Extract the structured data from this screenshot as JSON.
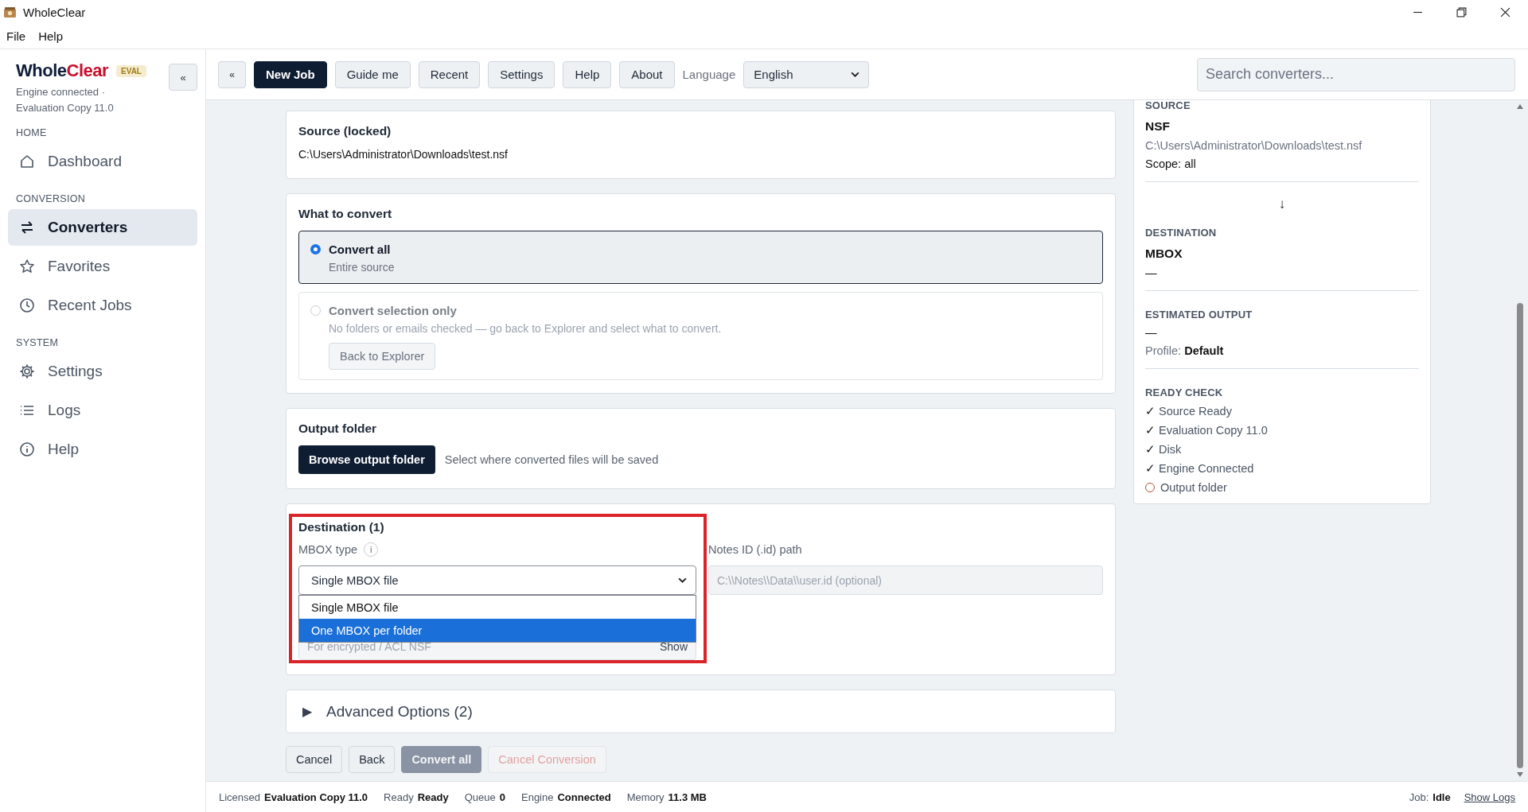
{
  "window": {
    "title": "WholeClear"
  },
  "menu": [
    "File",
    "Help"
  ],
  "sidebar": {
    "brand": {
      "primary": "Whole",
      "accent": "Clear"
    },
    "badge": "EVAL",
    "collapse": "«",
    "status": "Engine connected · Evaluation Copy 11.0",
    "sections": [
      {
        "title": "HOME",
        "items": [
          {
            "label": "Dashboard",
            "kind": "home",
            "selected": false
          }
        ]
      },
      {
        "title": "CONVERSION",
        "items": [
          {
            "label": "Converters",
            "kind": "swap",
            "selected": true
          },
          {
            "label": "Favorites",
            "kind": "star",
            "selected": false
          },
          {
            "label": "Recent Jobs",
            "kind": "clock",
            "selected": false
          }
        ]
      },
      {
        "title": "SYSTEM",
        "items": [
          {
            "label": "Settings",
            "kind": "gear",
            "selected": false
          },
          {
            "label": "Logs",
            "kind": "list",
            "selected": false
          },
          {
            "label": "Help",
            "kind": "info",
            "selected": false
          }
        ]
      }
    ]
  },
  "toolbar": {
    "collapse": "«",
    "buttons": [
      {
        "label": "New Job",
        "selected": true
      },
      {
        "label": "Guide me",
        "selected": false
      },
      {
        "label": "Recent",
        "selected": false
      },
      {
        "label": "Settings",
        "selected": false
      },
      {
        "label": "Help",
        "selected": false
      },
      {
        "label": "About",
        "selected": false
      }
    ],
    "language_label": "Language",
    "language": "English",
    "search": {
      "placeholder": "Search converters..."
    }
  },
  "source": {
    "title": "Source (locked)",
    "path": "C:\\Users\\Administrator\\Downloads\\test.nsf"
  },
  "what_to_convert": {
    "title": "What to convert",
    "options": [
      {
        "title": "Convert all",
        "subtitle": "Entire source",
        "selected": true,
        "disabled": false
      },
      {
        "title": "Convert selection only",
        "subtitle": "No folders or emails checked — go back to Explorer and select what to convert.",
        "selected": false,
        "disabled": true,
        "button": "Back to Explorer"
      }
    ]
  },
  "output_folder": {
    "title": "Output folder",
    "button": "Browse output folder",
    "hint": "Select where converted files will be saved"
  },
  "destination": {
    "title": "Destination (1)",
    "mbox_type": {
      "label": "MBOX type",
      "info": "i",
      "value": "Single MBOX file",
      "expanded": true,
      "options": [
        {
          "label": "Single MBOX file",
          "highlighted": false
        },
        {
          "label": "One MBOX per folder",
          "highlighted": true
        }
      ]
    },
    "notes_id": {
      "label": "Notes ID (.id) path",
      "placeholder": "C:\\\\Notes\\\\Data\\\\user.id (optional)"
    },
    "password": {
      "placeholder": "For encrypted / ACL NSF",
      "toggle": "Show"
    }
  },
  "advanced": {
    "label": "Advanced Options (2)",
    "toggle": "▶",
    "expanded": false
  },
  "actions": [
    {
      "label": "Cancel",
      "kind": "default",
      "disabled": false
    },
    {
      "label": "Back",
      "kind": "default",
      "disabled": false
    },
    {
      "label": "Convert all",
      "kind": "primary",
      "disabled": true
    },
    {
      "label": "Cancel Conversion",
      "kind": "danger",
      "disabled": true
    }
  ],
  "summary": {
    "source": {
      "label": "SOURCE",
      "value": "NSF",
      "path": "C:\\Users\\Administrator\\Downloads\\test.nsf",
      "scope": "Scope: all"
    },
    "arrow": "↓",
    "destination": {
      "label": "DESTINATION",
      "value": "MBOX",
      "detail": "—"
    },
    "estimate": {
      "label": "ESTIMATED OUTPUT",
      "value": "—",
      "profile": "Profile: **Default**"
    },
    "ready": {
      "label": "READY CHECK",
      "items": [
        {
          "mark": "✓",
          "label": "Source Ready",
          "done": true
        },
        {
          "mark": "✓",
          "label": "Evaluation Copy 11.0",
          "done": true
        },
        {
          "mark": "✓",
          "label": "Disk",
          "done": true
        },
        {
          "mark": "✓",
          "label": "Engine Connected",
          "done": true
        },
        {
          "label": "Output folder",
          "done": false
        }
      ]
    }
  },
  "status_bar": {
    "items": [
      {
        "label": "Licensed",
        "value": "Evaluation Copy 11.0"
      },
      {
        "label": "Ready",
        "value": "Ready"
      },
      {
        "label": "Queue",
        "value": "0"
      },
      {
        "label": "Engine",
        "value": "Connected"
      },
      {
        "label": "Memory",
        "value": "11.3 MB"
      }
    ],
    "job": {
      "label": "Job:",
      "value": "Idle"
    },
    "link": "Show Logs"
  }
}
